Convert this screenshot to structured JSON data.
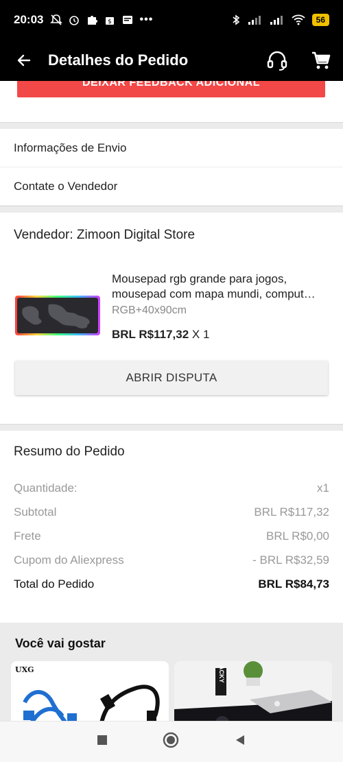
{
  "status_bar": {
    "time": "20:03",
    "battery": "56"
  },
  "header": {
    "title": "Detalhes do Pedido"
  },
  "feedback_button": "DEIXAR FEEDBACK ADICIONAL",
  "links": {
    "shipping": "Informações de Envio",
    "contact": "Contate o Vendedor"
  },
  "seller": {
    "label": "Vendedor: Zimoon Digital Store"
  },
  "product": {
    "name_line1": "Mousepad rgb grande para jogos,",
    "name_line2": "mousepad com mapa mundi, comput…",
    "variant": "RGB+40x90cm",
    "price": "BRL R$117,32",
    "qty": " X 1"
  },
  "dispute_button": "ABRIR DISPUTA",
  "summary": {
    "title": "Resumo do Pedido",
    "rows": [
      {
        "label": "Quantidade:",
        "value": "x1"
      },
      {
        "label": "Subtotal",
        "value": "BRL R$117,32"
      },
      {
        "label": "Frete",
        "value": "BRL R$0,00"
      },
      {
        "label": "Cupom do Aliexpress",
        "value": "- BRL R$32,59"
      }
    ],
    "total": {
      "label": "Total do Pedido",
      "value": "BRL R$84,73"
    }
  },
  "recommendations": {
    "title": "Você vai gostar",
    "brand_tag": "UXG",
    "card2_tag": "ACKY"
  },
  "colors": {
    "accent_red": "#f24848",
    "app_bar": "#000000",
    "battery": "#f0c000"
  },
  "icons": {
    "back": "arrow-left-icon",
    "support": "headset-icon",
    "cart": "cart-icon"
  }
}
